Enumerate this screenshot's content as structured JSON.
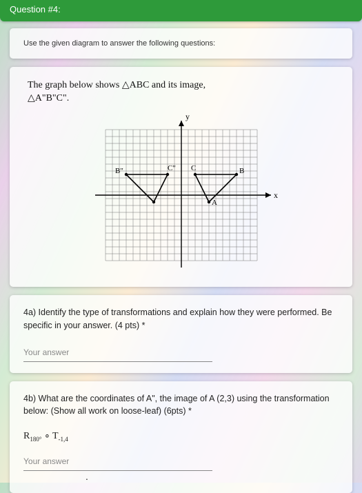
{
  "header": {
    "title": "Question #4:"
  },
  "instruction": "Use the given diagram to answer the following questions:",
  "diagram": {
    "title_line1": "The graph below shows △ABC and its image,",
    "title_line2": "△A\"B\"C\".",
    "axis_y": "y",
    "axis_x": "x",
    "labels": {
      "A": "A",
      "B": "B",
      "C": "C",
      "Aimg": "A\"",
      "Bimg": "B\"",
      "Cimg": "C\""
    },
    "points": {
      "A": [
        4,
        -1
      ],
      "B": [
        8,
        3
      ],
      "C": [
        2,
        3
      ],
      "Bimg": [
        -8,
        3
      ],
      "Cimg": [
        -2,
        3
      ],
      "Aimg_approx": [
        -4,
        -1
      ]
    }
  },
  "q4a": {
    "prompt": "4a) Identify the type of transformations and explain how they were performed. Be specific in your answer. (4 pts) *",
    "placeholder": "Your answer"
  },
  "q4b": {
    "prompt": "4b) What are the coordinates of A\", the image of A (2,3) using the transformation below: (Show all work on loose-leaf) (6pts) *",
    "formula_R": "R",
    "formula_Rsub": "180°",
    "formula_sep": " ∘ ",
    "formula_T": "T",
    "formula_Tsub": "-1,4",
    "placeholder": "Your answer"
  }
}
